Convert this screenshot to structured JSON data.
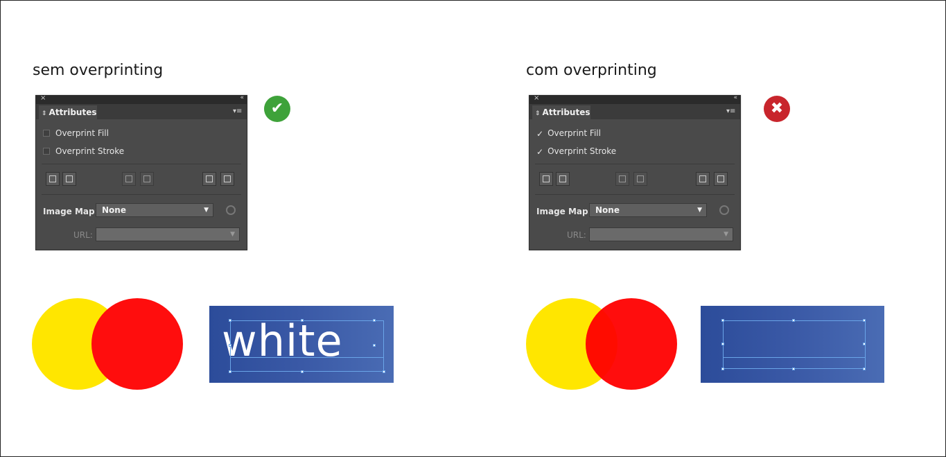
{
  "left": {
    "heading": "sem overprinting",
    "status_icon": "check-icon",
    "status_color": "#3ea23a",
    "panel": {
      "tab_title": "Attributes",
      "options": [
        {
          "label": "Overprint Fill",
          "checked": false
        },
        {
          "label": "Overprint Stroke",
          "checked": false
        }
      ],
      "image_map_label": "Image Map:",
      "image_map_value": "None",
      "url_label": "URL:",
      "url_value": ""
    },
    "circles": {
      "left_color": "#ffe600",
      "right_color": "#ff0d0d",
      "overlap": "red covers yellow (knockout)"
    },
    "text_sample": "white"
  },
  "right": {
    "heading": "com overprinting",
    "status_icon": "close-icon",
    "status_color": "#c8252c",
    "panel": {
      "tab_title": "Attributes",
      "options": [
        {
          "label": "Overprint Fill",
          "checked": true
        },
        {
          "label": "Overprint Stroke",
          "checked": true
        }
      ],
      "image_map_label": "Image Map:",
      "image_map_value": "None",
      "url_label": "URL:",
      "url_value": ""
    },
    "circles": {
      "left_color": "#ffe600",
      "right_color": "#ff0d0d",
      "overlap": "overprinted"
    },
    "text_sample": ""
  },
  "colors": {
    "blue_box": "#3a59a6",
    "selection": "#6aa5e8"
  },
  "glyphs": {
    "check": "✔",
    "cross": "✖",
    "tick": "✓",
    "close": "×",
    "collapse": "«",
    "caret": "▼",
    "diamond": "⇕"
  }
}
